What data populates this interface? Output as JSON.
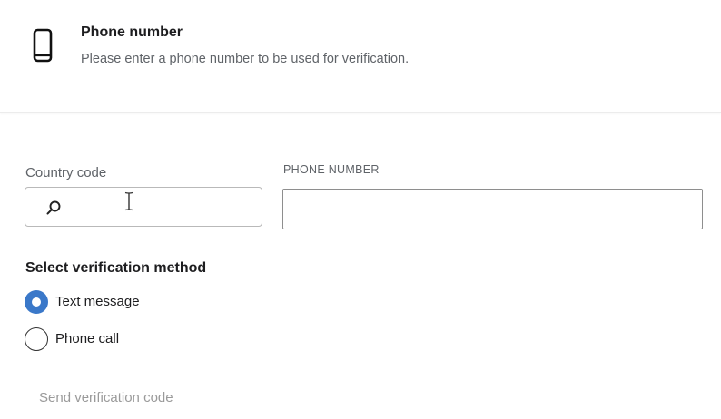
{
  "header": {
    "icon": "smartphone-icon",
    "title": "Phone number",
    "subtitle": "Please enter a phone number to be used for verification."
  },
  "form": {
    "country_code": {
      "label": "Country code",
      "value": "",
      "icon": "search-icon"
    },
    "phone_number": {
      "label": "PHONE NUMBER",
      "value": ""
    }
  },
  "verification": {
    "heading": "Select verification method",
    "options": [
      {
        "label": "Text message",
        "selected": true
      },
      {
        "label": "Phone call",
        "selected": false
      }
    ]
  },
  "actions": {
    "send_label": "Send verification code",
    "send_disabled": true
  },
  "colors": {
    "accent": "#3a78c9",
    "muted_text": "#5f6368",
    "disabled_text": "#9a9a9a"
  }
}
